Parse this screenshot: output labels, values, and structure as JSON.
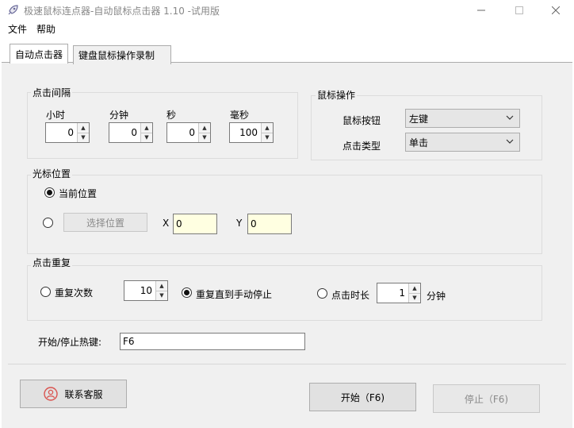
{
  "window": {
    "title": "极速鼠标连点器-自动鼠标点击器 1.10  -试用版"
  },
  "menu": {
    "file": "文件",
    "help": "帮助"
  },
  "tabs": {
    "auto_clicker": "自动点击器",
    "record": "键盘鼠标操作录制"
  },
  "interval": {
    "group_label": "点击间隔",
    "hours_label": "小时",
    "hours_value": "0",
    "minutes_label": "分钟",
    "minutes_value": "0",
    "seconds_label": "秒",
    "seconds_value": "0",
    "ms_label": "毫秒",
    "ms_value": "100"
  },
  "mouse_op": {
    "group_label": "鼠标操作",
    "button_label": "鼠标按钮",
    "button_value": "左键",
    "type_label": "点击类型",
    "type_value": "单击"
  },
  "cursor": {
    "group_label": "光标位置",
    "current_label": "当前位置",
    "pick_button": "选择位置",
    "x_label": "X",
    "x_value": "0",
    "y_label": "Y",
    "y_value": "0"
  },
  "repeat": {
    "group_label": "点击重复",
    "count_label": "重复次数",
    "count_value": "10",
    "until_stop_label": "重复直到手动停止",
    "duration_label": "点击时长",
    "duration_value": "1",
    "duration_unit": "分钟"
  },
  "hotkey": {
    "label": "开始/停止热键:",
    "value": "F6"
  },
  "footer": {
    "contact": "联系客服",
    "start": "开始（F6)",
    "stop": "停止（F6)"
  },
  "colors": {
    "accent_icon": "#d9534f",
    "coord_bg": "#ffffe1"
  }
}
